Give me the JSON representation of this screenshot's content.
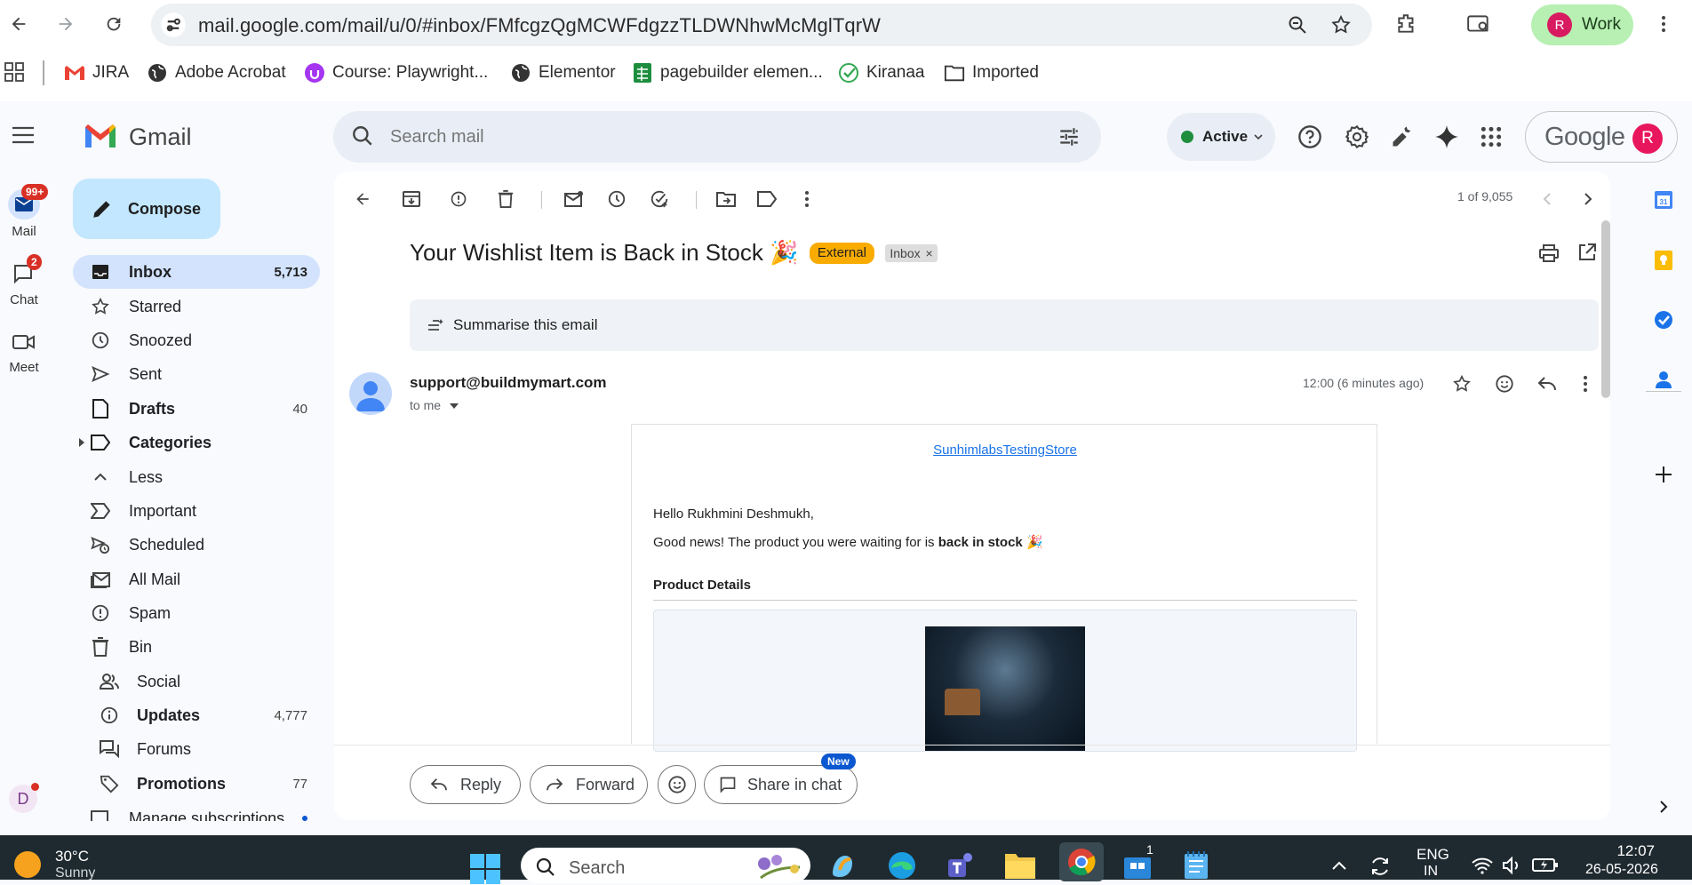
{
  "browser": {
    "url": "mail.google.com/mail/u/0/#inbox/FMfcgzQgMCWFdgzzTLDWNhwMcMglTqrW",
    "profile_initial": "R",
    "profile_label": "Work",
    "bookmarks": [
      {
        "label": "JIRA",
        "icon": "gmail-logo-icon"
      },
      {
        "label": "Adobe Acrobat",
        "icon": "globe-icon"
      },
      {
        "label": "Course: Playwright...",
        "icon": "udemy-icon"
      },
      {
        "label": "Elementor",
        "icon": "globe-icon"
      },
      {
        "label": "pagebuilder elemen...",
        "icon": "sheets-icon"
      },
      {
        "label": "Kiranaa",
        "icon": "check-icon"
      },
      {
        "label": "Imported",
        "icon": "folder-icon"
      }
    ]
  },
  "header": {
    "app_name": "Gmail",
    "search_placeholder": "Search mail",
    "status": "Active",
    "google_wordmark": "Google",
    "account_initial": "R"
  },
  "rail": {
    "mail_label": "Mail",
    "mail_badge": "99+",
    "chat_label": "Chat",
    "chat_badge": "2",
    "meet_label": "Meet",
    "user_initial": "D"
  },
  "sidebar": {
    "compose": "Compose",
    "items": [
      {
        "label": "Inbox",
        "count": "5,713"
      },
      {
        "label": "Starred",
        "count": ""
      },
      {
        "label": "Snoozed",
        "count": ""
      },
      {
        "label": "Sent",
        "count": ""
      },
      {
        "label": "Drafts",
        "count": "40"
      },
      {
        "label": "Categories",
        "count": ""
      },
      {
        "label": "Less",
        "count": ""
      },
      {
        "label": "Important",
        "count": ""
      },
      {
        "label": "Scheduled",
        "count": ""
      },
      {
        "label": "All Mail",
        "count": ""
      },
      {
        "label": "Spam",
        "count": ""
      },
      {
        "label": "Bin",
        "count": ""
      },
      {
        "label": "Social",
        "count": ""
      },
      {
        "label": "Updates",
        "count": "4,777"
      },
      {
        "label": "Forums",
        "count": ""
      },
      {
        "label": "Promotions",
        "count": "77"
      },
      {
        "label": "Manage subscriptions",
        "count": ""
      }
    ]
  },
  "toolbar": {
    "pagination": "1 of 9,055"
  },
  "email": {
    "subject": "Your Wishlist Item is Back in Stock 🎉",
    "tag_external": "External",
    "tag_inbox": "Inbox",
    "summarise": "Summarise this email",
    "sender": "support@buildmymart.com",
    "to": "to me",
    "time": "12:00 (6 minutes ago)",
    "store_link": "SunhimlabsTestingStore",
    "greeting": "Hello Rukhmini Deshmukh,",
    "line_prefix": "Good news! The product you were waiting for is ",
    "line_bold": "back in stock",
    "line_suffix": " 🎉",
    "product_heading": "Product Details"
  },
  "actions": {
    "reply": "Reply",
    "forward": "Forward",
    "share": "Share in chat",
    "new_badge": "New"
  },
  "taskbar": {
    "temp": "30°C",
    "weather": "Sunny",
    "search": "Search",
    "lang1": "ENG",
    "lang2": "IN",
    "time": "12:07",
    "date": "26-05-2026",
    "store_badge": "1"
  },
  "colors": {
    "accent": "#0b57d0",
    "compose_bg": "#c2e7ff",
    "inbox_active": "#d3e3fd",
    "external_tag": "#f9ab00",
    "active_dot": "#1e8e3e",
    "badge": "#d93025"
  }
}
